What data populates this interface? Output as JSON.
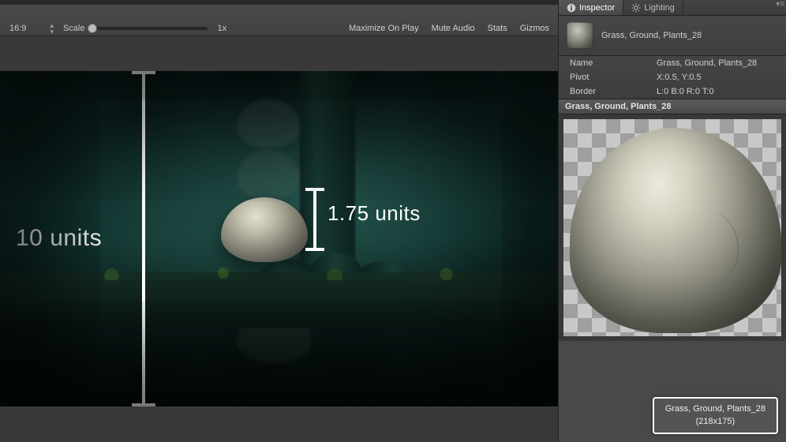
{
  "gameToolbar": {
    "aspect": "16:9",
    "scaleLabel": "Scale",
    "scaleValue": "1x",
    "maximizeOnPlay": "Maximize On Play",
    "muteAudio": "Mute Audio",
    "stats": "Stats",
    "gizmos": "Gizmos",
    "dragHandle": "▾≡"
  },
  "overlay": {
    "dim1": "10 units",
    "dim2": "1.75 units"
  },
  "inspector": {
    "tabs": {
      "inspector": "Inspector",
      "lighting": "Lighting"
    },
    "assetName": "Grass, Ground, Plants_28",
    "props": {
      "nameLabel": "Name",
      "nameValue": "Grass, Ground, Plants_28",
      "pivotLabel": "Pivot",
      "pivotValue": "X:0.5, Y:0.5",
      "borderLabel": "Border",
      "borderValue": "L:0 B:0 R:0 T:0"
    },
    "previewTitle": "Grass, Ground, Plants_28",
    "assetChip": {
      "name": "Grass, Ground, Plants_28",
      "dims": "(218x175)"
    }
  }
}
